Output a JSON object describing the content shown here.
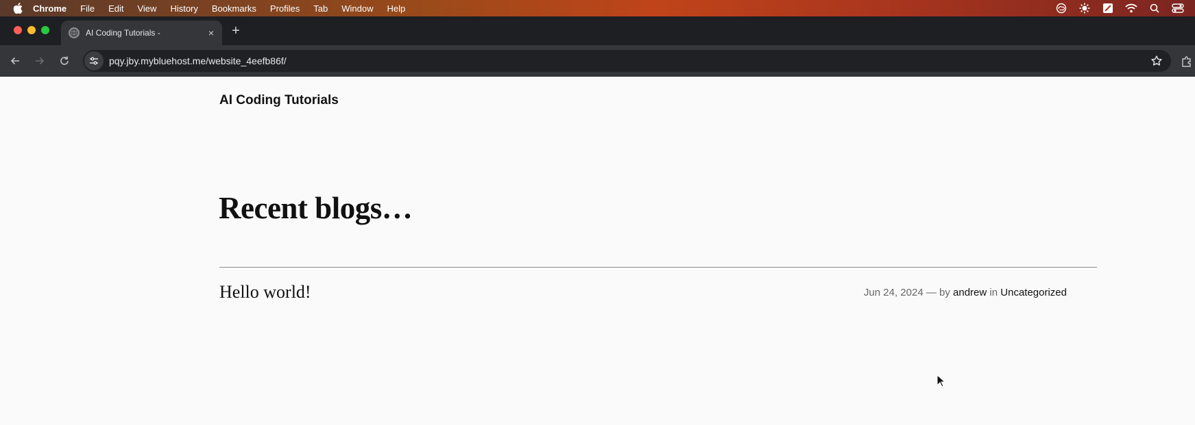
{
  "menubar": {
    "app_name": "Chrome",
    "items": [
      "File",
      "Edit",
      "View",
      "History",
      "Bookmarks",
      "Profiles",
      "Tab",
      "Window",
      "Help"
    ],
    "status_icons": [
      "creative-cloud-icon",
      "brightness-icon",
      "cast-icon",
      "wifi-icon",
      "search-icon",
      "control-center-icon"
    ]
  },
  "window": {
    "traffic_colors": [
      "#ff5f57",
      "#febc2e",
      "#28c840"
    ]
  },
  "tab": {
    "title": "AI Coding Tutorials -",
    "close_glyph": "×"
  },
  "newtab_glyph": "+",
  "omnibox": {
    "url": "pqy.jby.mybluehost.me/website_4eefb86f/"
  },
  "page": {
    "site_title": "AI Coding Tutorials",
    "heading": "Recent blogs…",
    "posts": [
      {
        "title": "Hello world!",
        "date": "Jun 24, 2024",
        "separator": "— by",
        "author": "andrew",
        "in": "in",
        "category": "Uncategorized"
      }
    ]
  }
}
